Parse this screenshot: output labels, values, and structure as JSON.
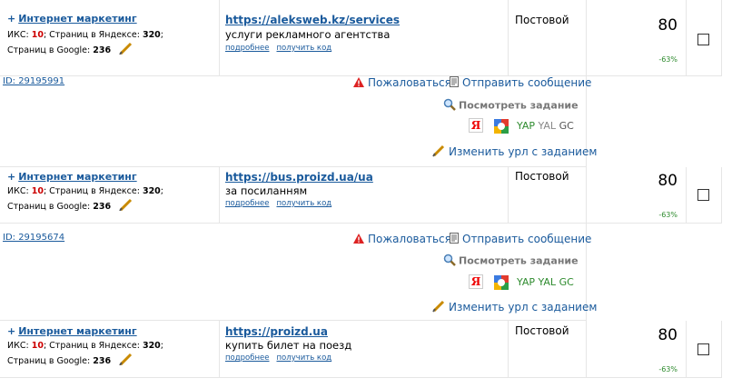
{
  "rows": [
    {
      "category": "Интернет маркетинг",
      "stats": {
        "iks_label": "ИКС:",
        "iks": "10",
        "yandex_label": "; Страниц в Яндексе:",
        "yandex": "320",
        "google_label": "Страниц в Google:",
        "google": "236"
      },
      "url": "https://aleksweb.kz/services",
      "description": "услуги рекламного агентства",
      "more": "подробнее",
      "code": "получить код",
      "type": "Постовой",
      "price": "80",
      "discount": "-63%",
      "id": "ID: 29195991",
      "se": {
        "yap": "YAP",
        "yal": "YAL",
        "gc": "GC",
        "yal_active": false
      }
    },
    {
      "category": "Интернет маркетинг",
      "stats": {
        "iks_label": "ИКС:",
        "iks": "10",
        "yandex_label": "; Страниц в Яндексе:",
        "yandex": "320",
        "google_label": "Страниц в Google:",
        "google": "236"
      },
      "url": "https://bus.proizd.ua/ua",
      "description": "за посиланням",
      "more": "подробнее",
      "code": "получить код",
      "type": "Постовой",
      "price": "80",
      "discount": "-63%",
      "id": "ID: 29195674",
      "se": {
        "yap": "YAP",
        "yal": "YAL",
        "gc": "GC",
        "yal_active": true
      }
    },
    {
      "category": "Интернет маркетинг",
      "stats": {
        "iks_label": "ИКС:",
        "iks": "10",
        "yandex_label": "; Страниц в Яндексе:",
        "yandex": "320",
        "google_label": "Страниц в Google:",
        "google": "236"
      },
      "url": "https://proizd.ua",
      "description": "купить билет на поезд",
      "more": "подробнее",
      "code": "получить код",
      "type": "Постовой",
      "price": "80",
      "discount": "-63%"
    }
  ],
  "actions": {
    "complain": "Пожаловаться",
    "message": "Отправить сообщение",
    "view_task": "Посмотреть задание",
    "yandex_letter": "Я",
    "change_url": "Изменить урл с заданием"
  }
}
